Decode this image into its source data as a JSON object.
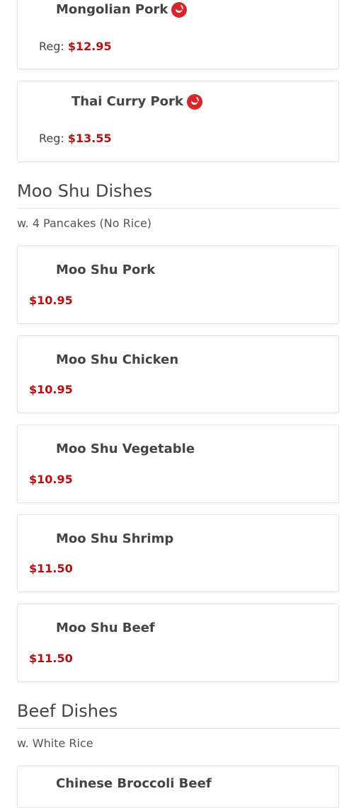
{
  "items_top": [
    {
      "name": "Mongolian Pork",
      "price_prefix": "Reg:",
      "price": "$12.95",
      "spicy_icon": "chili-pepper"
    },
    {
      "name": "Thai Curry Pork",
      "price_prefix": "Reg:",
      "price": "$13.55",
      "spicy_icon": "chili-pepper"
    }
  ],
  "moo_shu": {
    "title": "Moo Shu Dishes",
    "note": "w. 4 Pancakes (No Rice)",
    "items": [
      {
        "name": "Moo Shu Pork",
        "price": "$10.95"
      },
      {
        "name": "Moo Shu Chicken",
        "price": "$10.95"
      },
      {
        "name": "Moo Shu Vegetable",
        "price": "$10.95"
      },
      {
        "name": "Moo Shu Shrimp",
        "price": "$11.50"
      },
      {
        "name": "Moo Shu Beef",
        "price": "$11.50"
      }
    ]
  },
  "beef": {
    "title": "Beef Dishes",
    "note": "w. White Rice",
    "items": [
      {
        "name": "Chinese Broccoli Beef"
      }
    ]
  },
  "colors": {
    "price": "#b01010",
    "spicy_icon": "#d7262b"
  }
}
